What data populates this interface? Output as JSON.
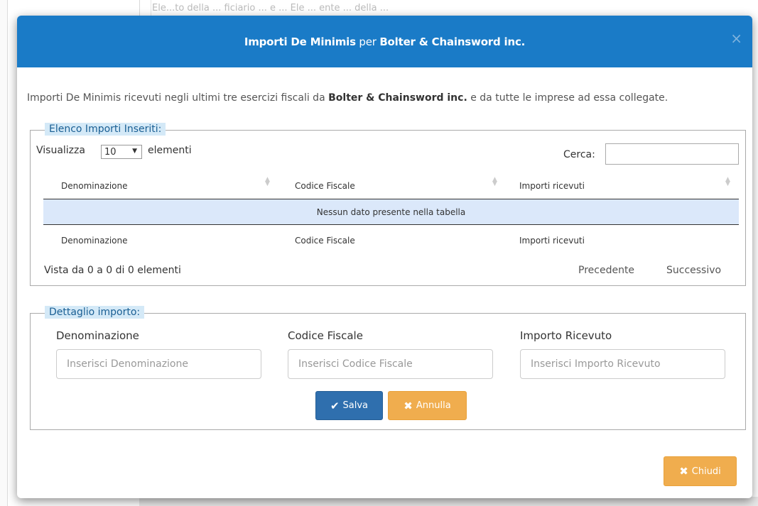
{
  "background": {
    "snippet": "Ele...to della ... ficiario ... e ... Ele ... ente ... della ... "
  },
  "modal": {
    "title_part1": "Importi De Minimis",
    "title_part2": " per ",
    "title_part3": "Bolter & Chainsword inc.",
    "close_symbol": "×",
    "intro_before": "Importi De Minimis ricevuti negli ultimi tre esercizi fiscali da ",
    "intro_company": "Bolter & Chainsword inc.",
    "intro_after": " e da tutte le imprese ad essa collegate."
  },
  "list": {
    "legend": "Elenco Importi Inseriti:",
    "show_label": "Visualizza",
    "page_size": "10",
    "show_after": "elementi",
    "search_label": "Cerca:",
    "columns": [
      "Denominazione",
      "Codice Fiscale",
      "Importi ricevuti"
    ],
    "empty_message": "Nessun dato presente nella tabella",
    "info": "Vista da 0 a 0 di 0 elementi",
    "prev": "Precedente",
    "next": "Successivo"
  },
  "detail": {
    "legend": "Dettaglio importo:",
    "fields": [
      {
        "label": "Denominazione",
        "placeholder": "Inserisci Denominazione",
        "value": ""
      },
      {
        "label": "Codice Fiscale",
        "placeholder": "Inserisci Codice Fiscale",
        "value": ""
      },
      {
        "label": "Importo Ricevuto",
        "placeholder": "Inserisci Importo Ricevuto",
        "value": ""
      }
    ],
    "save_label": "Salva",
    "cancel_label": "Annulla"
  },
  "footer": {
    "close_label": "Chiudi"
  },
  "colors": {
    "header_blue": "#1a7bc7",
    "primary": "#2f6fae",
    "warning": "#f0ad4e",
    "legend_bg": "#d4e9f7",
    "empty_row_bg": "#dbe8fa"
  }
}
